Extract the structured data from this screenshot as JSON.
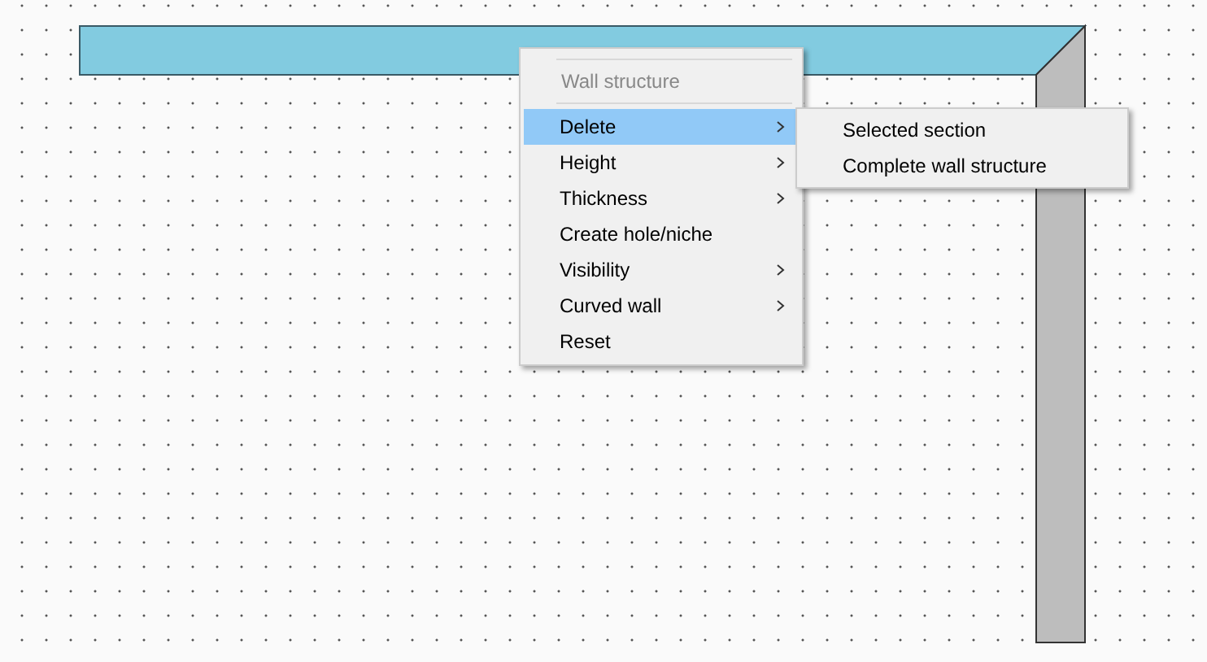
{
  "context_menu": {
    "title": "Wall structure",
    "items": [
      {
        "label": "Delete",
        "submenu": true,
        "selected": true
      },
      {
        "label": "Height",
        "submenu": true,
        "selected": false
      },
      {
        "label": "Thickness",
        "submenu": true,
        "selected": false
      },
      {
        "label": "Create hole/niche",
        "submenu": false,
        "selected": false
      },
      {
        "label": "Visibility",
        "submenu": true,
        "selected": false
      },
      {
        "label": "Curved wall",
        "submenu": true,
        "selected": false
      },
      {
        "label": "Reset",
        "submenu": false,
        "selected": false
      }
    ]
  },
  "submenu": {
    "items": [
      {
        "label": "Selected section"
      },
      {
        "label": "Complete wall structure"
      }
    ]
  }
}
